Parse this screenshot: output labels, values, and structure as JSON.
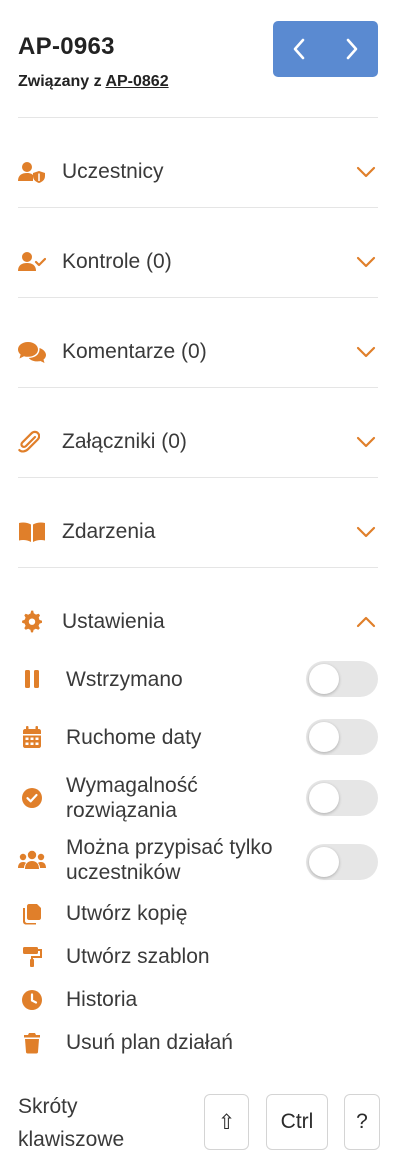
{
  "header": {
    "id": "AP-0963",
    "related_prefix": "Związany z",
    "related_id": "AP-0862"
  },
  "sections": [
    {
      "label": "Uczestnicy",
      "icon": "users-shield-icon",
      "state": "collapsed"
    },
    {
      "label": "Kontrole (0)",
      "icon": "user-check-icon",
      "state": "collapsed"
    },
    {
      "label": "Komentarze (0)",
      "icon": "comments-icon",
      "state": "collapsed"
    },
    {
      "label": "Załączniki (0)",
      "icon": "paperclip-icon",
      "state": "collapsed"
    },
    {
      "label": "Zdarzenia",
      "icon": "book-open-icon",
      "state": "collapsed"
    },
    {
      "label": "Ustawienia",
      "icon": "gear-icon",
      "state": "expanded"
    }
  ],
  "settings": {
    "toggles": [
      {
        "label": "Wstrzymano",
        "icon": "pause-icon",
        "on": false
      },
      {
        "label": "Ruchome daty",
        "icon": "calendar-icon",
        "on": false
      },
      {
        "label": "Wymagalność rozwiązania",
        "icon": "check-circle-icon",
        "on": false
      },
      {
        "label": "Można przypisać tylko uczestników",
        "icon": "users-icon",
        "on": false
      }
    ],
    "actions": [
      {
        "label": "Utwórz kopię",
        "icon": "copy-icon"
      },
      {
        "label": "Utwórz szablon",
        "icon": "paint-roller-icon"
      },
      {
        "label": "Historia",
        "icon": "clock-icon"
      },
      {
        "label": "Usuń plan działań",
        "icon": "trash-icon"
      }
    ]
  },
  "shortcuts": {
    "label": "Skróty klawiszowe",
    "keys": [
      "⇧",
      "Ctrl",
      "?"
    ]
  },
  "colors": {
    "accent": "#e07f2a",
    "primary_button": "#5a8ad1",
    "toggle_off": "#e6e6e6"
  }
}
